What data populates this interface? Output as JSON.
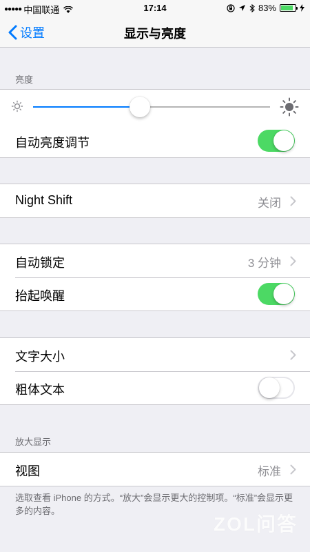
{
  "status_bar": {
    "signal_dots": "●●●●●",
    "carrier": "中国联通",
    "wifi_icon": "wifi-icon",
    "time": "17:14",
    "battery": "83%",
    "battery_level": 0.83
  },
  "nav": {
    "back_label": "设置",
    "title": "显示与亮度"
  },
  "brightness": {
    "header": "亮度",
    "level": 0.45,
    "auto_label": "自动亮度调节",
    "auto_on": true
  },
  "night_shift": {
    "label": "Night Shift",
    "value": "关闭"
  },
  "lock": {
    "auto_lock_label": "自动锁定",
    "auto_lock_value": "3 分钟",
    "raise_to_wake_label": "抬起唤醒",
    "raise_to_wake_on": true
  },
  "text": {
    "text_size_label": "文字大小",
    "bold_text_label": "粗体文本",
    "bold_text_on": false
  },
  "zoom": {
    "header": "放大显示",
    "view_label": "视图",
    "view_value": "标准",
    "footer": "选取查看 iPhone 的方式。“放大”会显示更大的控制项。“标准”会显示更多的内容。"
  },
  "watermark": "ZOL问答",
  "colors": {
    "accent": "#007aff",
    "toggle_on": "#4cd964",
    "background": "#efeff4"
  }
}
